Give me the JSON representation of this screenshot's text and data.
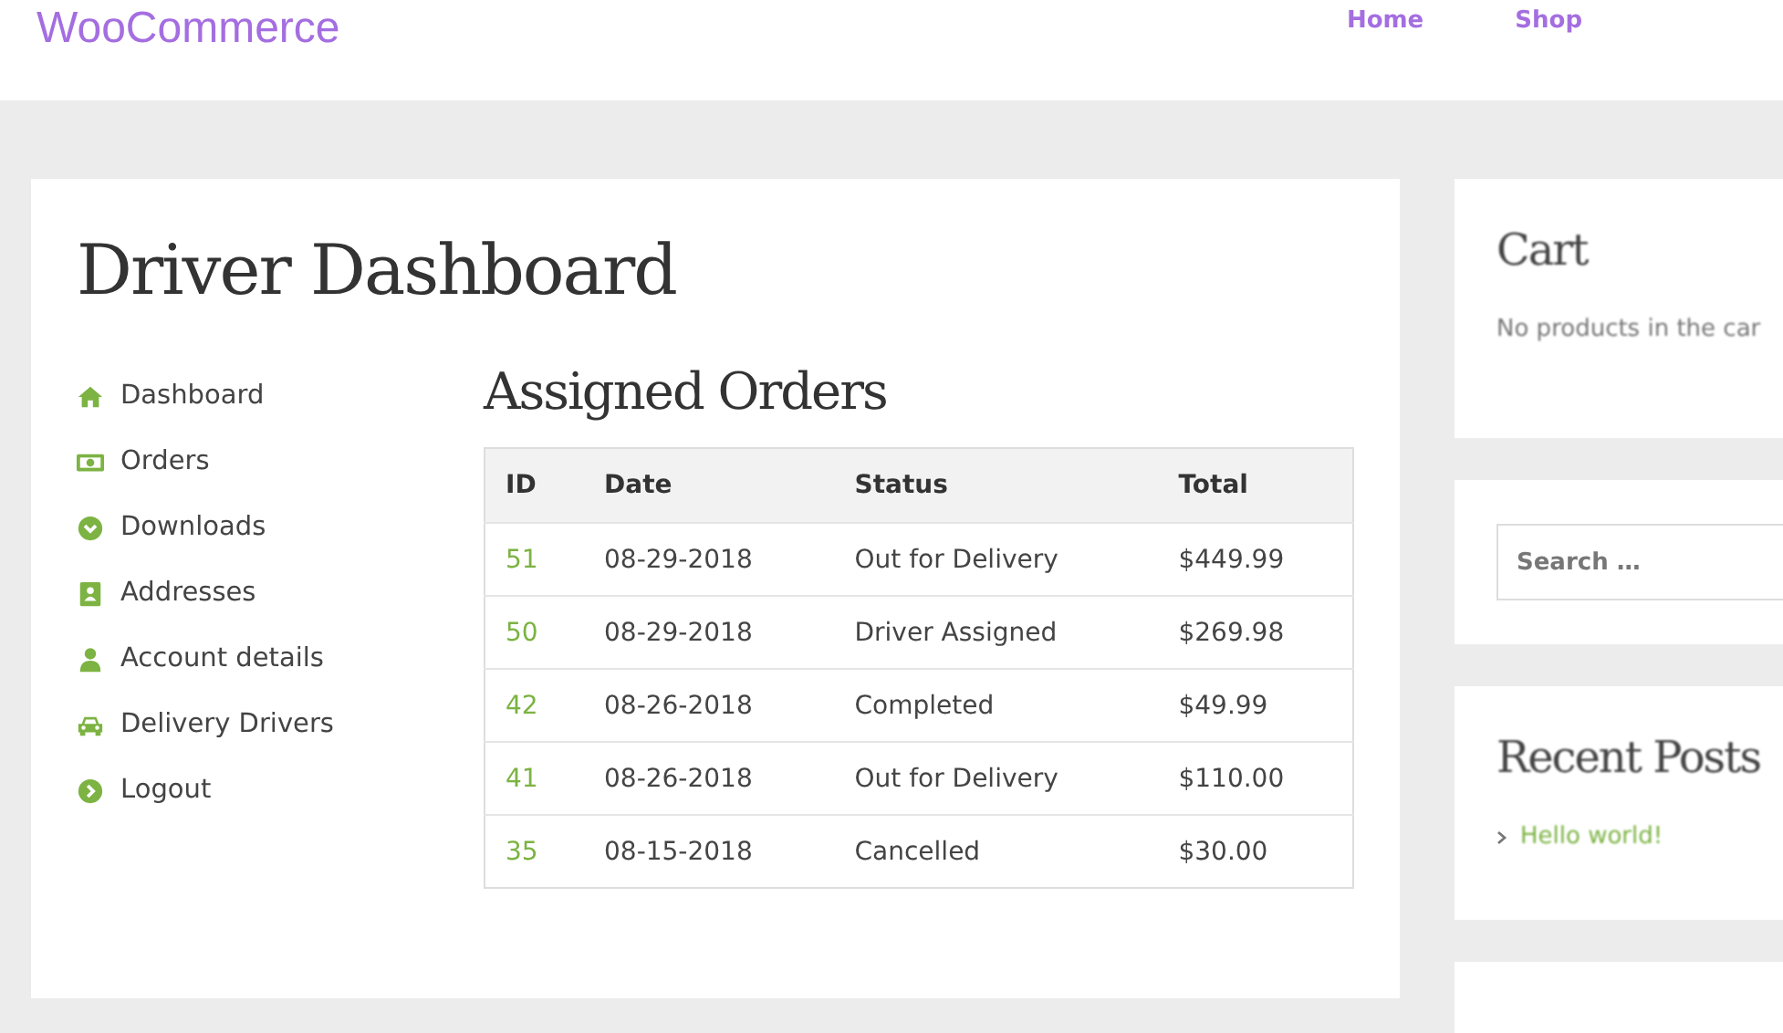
{
  "header": {
    "logo": "WooCommerce",
    "nav": [
      "Home",
      "Shop"
    ]
  },
  "main": {
    "title": "Driver Dashboard",
    "menu": [
      "Dashboard",
      "Orders",
      "Downloads",
      "Addresses",
      "Account details",
      "Delivery Drivers",
      "Logout"
    ],
    "orders_title": "Assigned Orders",
    "table": {
      "columns": [
        "ID",
        "Date",
        "Status",
        "Total"
      ],
      "rows": [
        {
          "id": "51",
          "date": "08-29-2018",
          "status": "Out for Delivery",
          "total": "$449.99"
        },
        {
          "id": "50",
          "date": "08-29-2018",
          "status": "Driver Assigned",
          "total": "$269.98"
        },
        {
          "id": "42",
          "date": "08-26-2018",
          "status": "Completed",
          "total": "$49.99"
        },
        {
          "id": "41",
          "date": "08-26-2018",
          "status": "Out for Delivery",
          "total": "$110.00"
        },
        {
          "id": "35",
          "date": "08-15-2018",
          "status": "Cancelled",
          "total": "$30.00"
        }
      ]
    }
  },
  "sidebar": {
    "cart": {
      "title": "Cart",
      "text": "No products in the car"
    },
    "search": {
      "placeholder": "Search …"
    },
    "recent_posts": {
      "title": "Recent Posts",
      "items": [
        "Hello world!"
      ]
    }
  }
}
